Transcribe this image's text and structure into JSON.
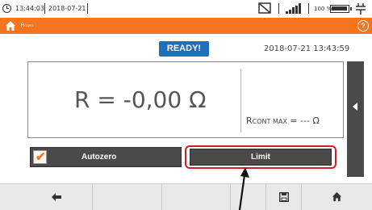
{
  "status_bar": {
    "time": "13:44:03",
    "date": "2018-07-21",
    "battery_percent": "100 %",
    "battery_level": 1.0,
    "icons": [
      "clock-icon",
      "screen-icon",
      "signal-icon",
      "battery-icon",
      "plug-icon"
    ]
  },
  "title_bar": {
    "title_main": "R",
    "title_sub": "CONT",
    "accent_color": "#f5751f",
    "icons": [
      "home-icon",
      "help-icon"
    ]
  },
  "main": {
    "status_badge": "READY!",
    "badge_color": "#1f6fb9",
    "timestamp": "2018-07-21 13:43:59",
    "result": "R = -0,00 Ω",
    "limit": {
      "label_main": "R",
      "label_sub": "CONT MAX",
      "value_text": " = --- Ω"
    }
  },
  "controls": {
    "autozero_label": "Autozero",
    "autozero_checked": true,
    "limit_label": "Limit",
    "highlight_color": "#d31c27"
  },
  "bottom_nav": {
    "items": [
      "back-arrow-icon",
      "empty",
      "empty",
      "empty",
      "save-icon",
      "home-icon"
    ]
  }
}
